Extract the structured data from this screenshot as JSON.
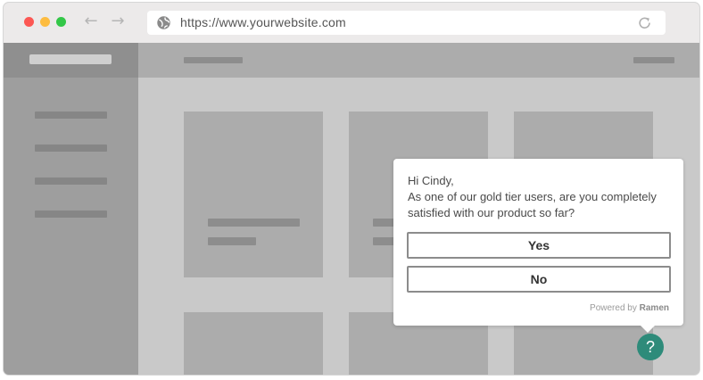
{
  "browser": {
    "url": "https://www.yourwebsite.com",
    "back_arrow": "←",
    "forward_arrow": "→"
  },
  "survey": {
    "greeting": "Hi Cindy,",
    "question_line1": "As one of our gold tier users, are you completely",
    "question_line2": "satisfied with our product so far?",
    "yes_label": "Yes",
    "no_label": "No",
    "powered_prefix": "Powered by",
    "powered_brand": "Ramen"
  },
  "help_button": {
    "label": "?"
  },
  "colors": {
    "accent": "#2e8b7a",
    "close": "#fc5753",
    "minimize": "#fdbc40",
    "maximize": "#33c748"
  },
  "icons": [
    "globe-icon",
    "reload-icon",
    "back-arrow-icon",
    "forward-arrow-icon",
    "help-icon"
  ]
}
